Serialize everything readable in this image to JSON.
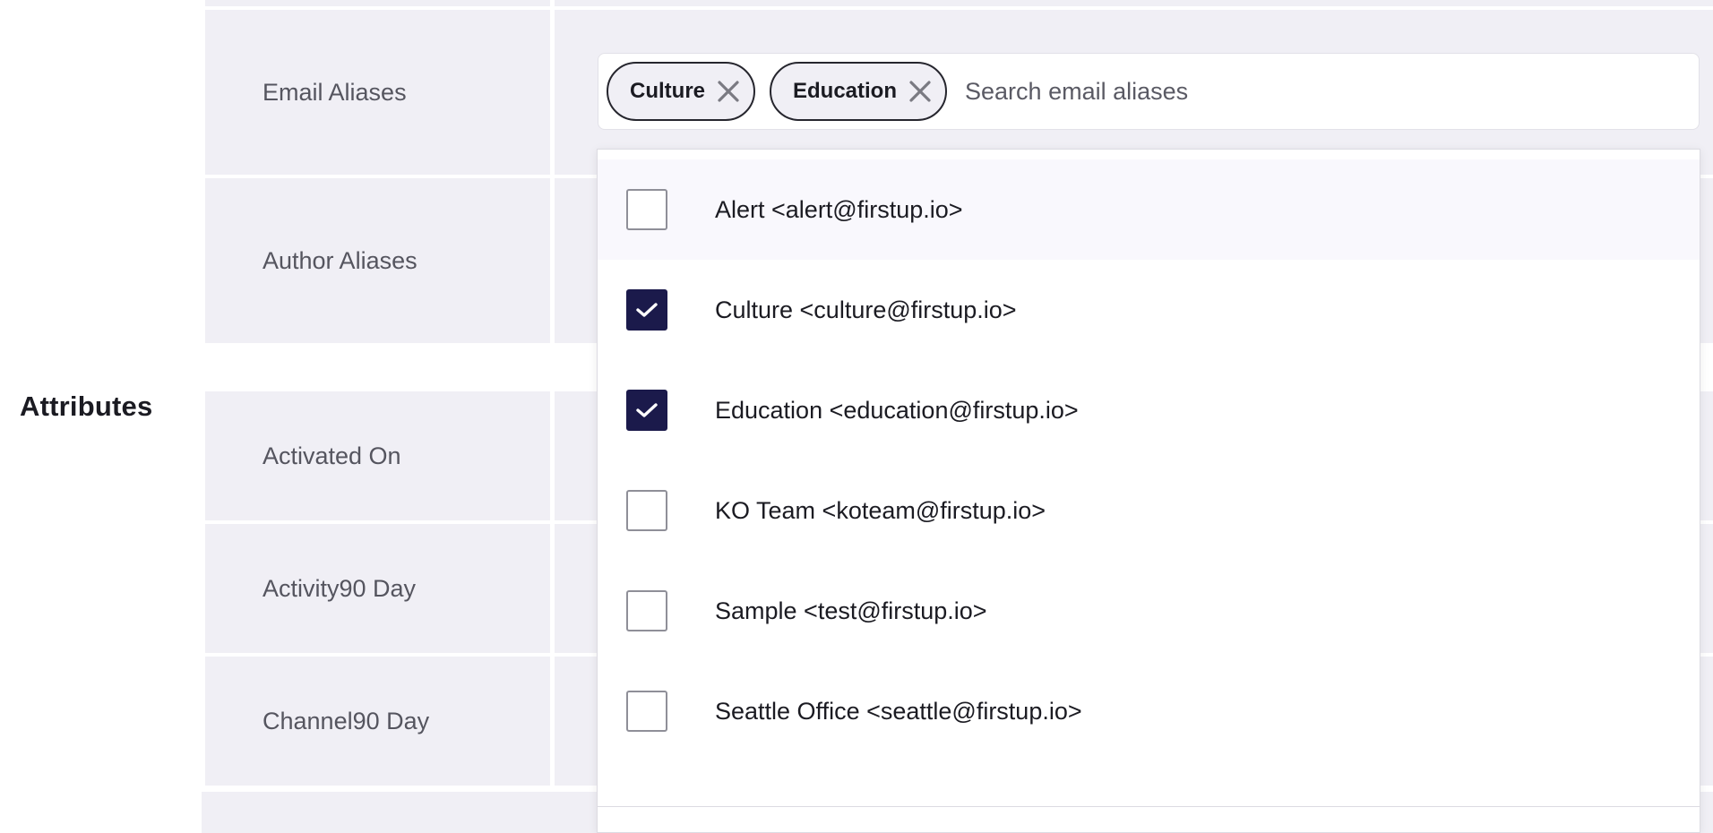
{
  "rows": {
    "email_aliases": "Email Aliases",
    "author_aliases": "Author Aliases",
    "activated_on": "Activated On",
    "activity90_day": "Activity90 Day",
    "channel90_day": "Channel90 Day"
  },
  "section_title": "Attributes",
  "email_aliases_field": {
    "chips": [
      {
        "label": "Culture",
        "remove_icon": "close-icon"
      },
      {
        "label": "Education",
        "remove_icon": "close-icon"
      }
    ],
    "placeholder": "Search email aliases"
  },
  "dropdown": {
    "options": [
      {
        "label": "Alert <alert@firstup.io>",
        "checked": false
      },
      {
        "label": "Culture <culture@firstup.io>",
        "checked": true
      },
      {
        "label": "Education <education@firstup.io>",
        "checked": true
      },
      {
        "label": "KO Team <koteam@firstup.io>",
        "checked": false
      },
      {
        "label": "Sample <test@firstup.io>",
        "checked": false
      },
      {
        "label": "Seattle Office <seattle@firstup.io>",
        "checked": false
      }
    ]
  },
  "colors": {
    "row_background": "#f0eff5",
    "checkbox_checked": "#1b1a4b",
    "highlight": "#f9f8fd"
  }
}
